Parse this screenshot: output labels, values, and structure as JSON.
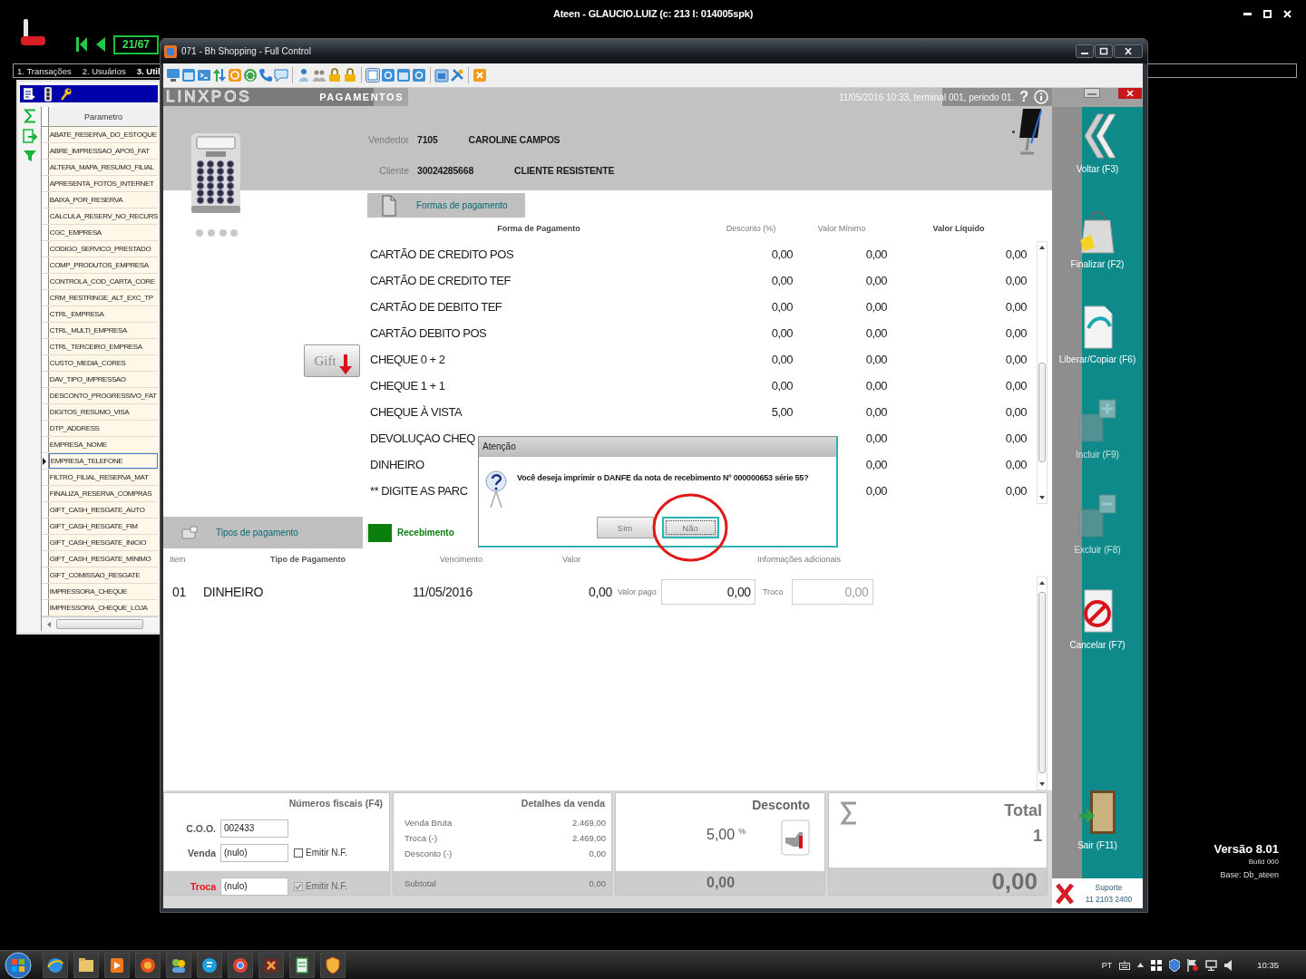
{
  "app": {
    "title": "Ateen - GLAUCIO.LUIZ (c: 213 l: 014005spk)",
    "counter": "21/67",
    "menu": [
      {
        "label": "1. Transações",
        "selected": false
      },
      {
        "label": "2. Usuários",
        "selected": false
      },
      {
        "label": "3. Util",
        "selected": true
      }
    ]
  },
  "parameters": {
    "column": "Parametro",
    "rows": [
      {
        "name": "ABATE_RESERVA_DO_ESTOQUE",
        "selected": false
      },
      {
        "name": "ABRE_IMPRESSAO_APOS_FAT",
        "selected": false
      },
      {
        "name": "ALTERA_MAPA_RESUMO_FILIAL",
        "selected": false
      },
      {
        "name": "APRESENTA_FOTOS_INTERNET",
        "selected": false
      },
      {
        "name": "BAIXA_POR_RESERVA",
        "selected": false
      },
      {
        "name": "CALCULA_RESERV_NO_RECURS",
        "selected": false
      },
      {
        "name": "CGC_EMPRESA",
        "selected": false
      },
      {
        "name": "CODIGO_SERVICO_PRESTADO",
        "selected": false
      },
      {
        "name": "COMP_PRODUTOS_EMPRESA",
        "selected": false
      },
      {
        "name": "CONTROLA_COD_CARTA_CORE",
        "selected": false
      },
      {
        "name": "CRM_RESTRINGE_ALT_EXC_TP",
        "selected": false
      },
      {
        "name": "CTRL_EMPRESA",
        "selected": false
      },
      {
        "name": "CTRL_MULTI_EMPRESA",
        "selected": false
      },
      {
        "name": "CTRL_TERCEIRO_EMPRESA",
        "selected": false
      },
      {
        "name": "CUSTO_MEDIA_CORES",
        "selected": false
      },
      {
        "name": "DAV_TIPO_IMPRESSAO",
        "selected": false
      },
      {
        "name": "DESCONTO_PROGRESSIVO_FAT",
        "selected": false
      },
      {
        "name": "DIGITOS_RESUMO_VISA",
        "selected": false
      },
      {
        "name": "DTP_ADDRESS",
        "selected": false
      },
      {
        "name": "EMPRESA_NOME",
        "selected": false
      },
      {
        "name": "EMPRESA_TELEFONE",
        "selected": true
      },
      {
        "name": "FILTRO_FILIAL_RESERVA_MAT",
        "selected": false
      },
      {
        "name": "FINALIZA_RESERVA_COMPRAS",
        "selected": false
      },
      {
        "name": "GIFT_CASH_RESGATE_AUTO",
        "selected": false
      },
      {
        "name": "GIFT_CASH_RESGATE_FIM",
        "selected": false
      },
      {
        "name": "GIFT_CASH_RESGATE_INICIO",
        "selected": false
      },
      {
        "name": "GIFT_CASH_RESGATE_MINIMO",
        "selected": false
      },
      {
        "name": "GIFT_COMISSAO_RESGATE",
        "selected": false
      },
      {
        "name": "IMPRESSORA_CHEQUE",
        "selected": false
      },
      {
        "name": "IMPRESSORA_CHEQUE_LOJA",
        "selected": false
      }
    ]
  },
  "window": {
    "title": "071 - Bh Shopping - Full Control"
  },
  "header": {
    "logo": "LINXPOS",
    "screen": "PAGAMENTOS",
    "session": "11/05/2016 10:33, terminal 001, periodo 01.",
    "help": "?",
    "vendor": {
      "label": "Vendedor",
      "code": "7105",
      "name": "CAROLINE CAMPOS"
    },
    "client": {
      "label": "Cliente",
      "code": "30024285668",
      "name": "CLIENTE RESISTENTE"
    }
  },
  "gift_card": {
    "label": "Gift"
  },
  "payment_methods": {
    "tab": "Formas de pagamento",
    "columns": [
      {
        "label": "Forma de Pagamento",
        "bold": true
      },
      {
        "label": "Desconto (%)",
        "bold": false
      },
      {
        "label": "Valor Mínimo",
        "bold": false
      },
      {
        "label": "Valor Líquido",
        "bold": true
      }
    ],
    "rows": [
      {
        "name": "CARTÃO DE CREDITO POS",
        "discount": "0,00",
        "minimum": "0,00",
        "net": "0,00"
      },
      {
        "name": "CARTÃO DE CREDITO TEF",
        "discount": "0,00",
        "minimum": "0,00",
        "net": "0,00"
      },
      {
        "name": "CARTÃO DE DEBITO TEF",
        "discount": "0,00",
        "minimum": "0,00",
        "net": "0,00"
      },
      {
        "name": "CARTÃO DEBITO POS",
        "discount": "0,00",
        "minimum": "0,00",
        "net": "0,00"
      },
      {
        "name": "CHEQUE 0 + 2",
        "discount": "0,00",
        "minimum": "0,00",
        "net": "0,00"
      },
      {
        "name": "CHEQUE 1 + 1",
        "discount": "0,00",
        "minimum": "0,00",
        "net": "0,00"
      },
      {
        "name": "CHEQUE À VISTA",
        "discount": "5,00",
        "minimum": "0,00",
        "net": "0,00"
      },
      {
        "name": "DEVOLUÇAO CHEQ",
        "minimum": "0,00",
        "net": "0,00"
      },
      {
        "name": "DINHEIRO",
        "minimum": "0,00",
        "net": "0,00"
      },
      {
        "name": "** DIGITE AS PARC",
        "minimum": "0,00",
        "net": "0,00"
      }
    ]
  },
  "receipt": {
    "tab": "Tipos de pagamento",
    "title": "Recebimento",
    "columns": [
      {
        "label": "Item",
        "bold": false
      },
      {
        "label": "Tipo de Pagamento",
        "bold": true
      },
      {
        "label": "Vencimento",
        "bold": false
      },
      {
        "label": "Valor",
        "bold": false
      },
      {
        "label": "Informações adicionais",
        "bold": false
      }
    ],
    "rows": [
      {
        "item": "01",
        "type": "DINHEIRO",
        "due": "11/05/2016",
        "value": "0,00",
        "paid": {
          "label": "Valor pago",
          "value": "0,00",
          "disabled": false
        },
        "change": {
          "label": "Troco",
          "value": "0,00",
          "disabled": true
        }
      }
    ]
  },
  "fiscal": {
    "title": "Números fiscais (F4)",
    "rows": [
      {
        "kind": "field",
        "label": "C.O.O.",
        "value": "002433"
      },
      {
        "kind": "field_check",
        "label": "Venda",
        "value": "(nulo)",
        "option": "Emitir N.F.",
        "checked": false,
        "disabled": false,
        "alert": false
      }
    ],
    "footer": {
      "kind": "field_check",
      "label": "Troca",
      "value": "(nulo)",
      "option": "Emitir N.F.",
      "checked": true,
      "disabled": true,
      "alert": true
    }
  },
  "sale_details": {
    "title": "Detalhes da venda",
    "rows": [
      {
        "label": "Venda Bruta",
        "value": "2.469,00"
      },
      {
        "label": "Troca (-)",
        "value": "2.469,00"
      },
      {
        "label": "Desconto (-)",
        "value": "0,00"
      }
    ],
    "footer": {
      "label": "Subtotal",
      "value": "0,00",
      "disabled": true
    }
  },
  "discount": {
    "title": "Desconto",
    "percent": "5,00",
    "unit": "%",
    "amount": "0,00"
  },
  "total": {
    "title": "Total",
    "count": "1",
    "amount": "0,00"
  },
  "sidebar": {
    "buttons": [
      {
        "label": "Voltar (F3)",
        "kind": "back",
        "disabled": false
      },
      {
        "label": "Finalizar (F2)",
        "kind": "finish",
        "disabled": false
      },
      {
        "label": "Liberar/Copiar (F6)",
        "kind": "copy",
        "disabled": false
      },
      {
        "label": "Incluir (F9)",
        "kind": "add",
        "disabled": true
      },
      {
        "label": "Excluir (F8)",
        "kind": "remove",
        "disabled": true
      },
      {
        "label": "Cancelar (F7)",
        "kind": "cancel",
        "disabled": false
      },
      {
        "label": "Sair (F11)",
        "kind": "exit",
        "disabled": false
      }
    ],
    "support": {
      "label": "Suporte",
      "phone": "11 2103 2400"
    }
  },
  "dialog": {
    "title": "Atenção",
    "message": "Você deseja imprimir o DANFE da nota de recebimento Nº 000000653 série 55?",
    "buttons": [
      {
        "label": "Sim",
        "selected": false
      },
      {
        "label": "Não",
        "selected": true
      }
    ]
  },
  "version": {
    "title": "Versão 8.01",
    "build": "Build 000",
    "base": "Base: Db_ateen"
  },
  "taskbar": {
    "language": "PT",
    "clock": "10:35"
  }
}
